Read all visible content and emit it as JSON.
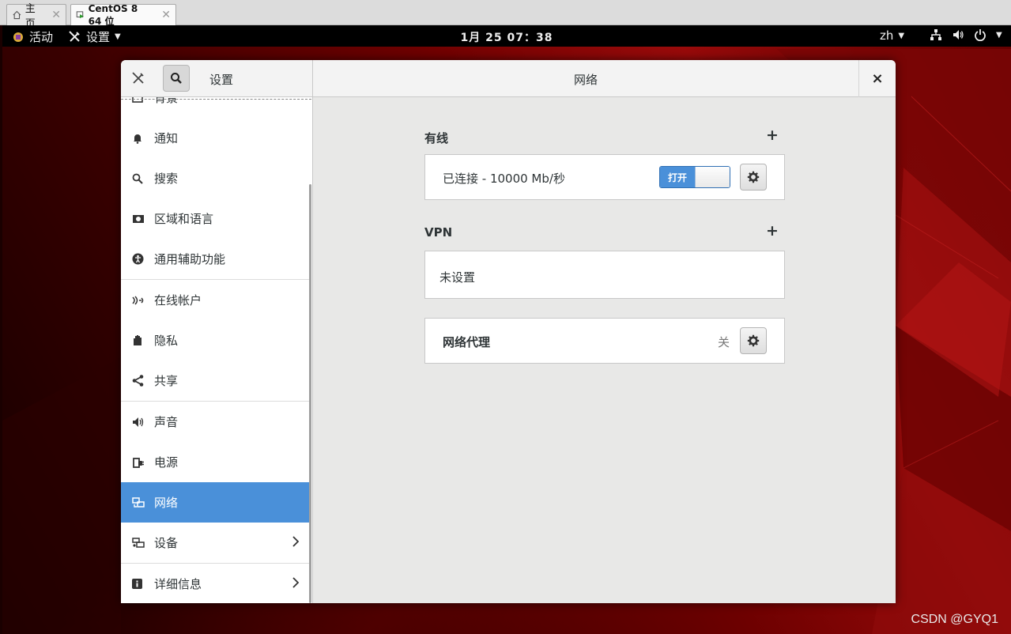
{
  "vmware_tabs": [
    {
      "label": "主页"
    },
    {
      "label": "CentOS 8 64 位"
    }
  ],
  "topbar": {
    "activities": "活动",
    "app_menu": "设置",
    "clock": "1月 25  07：38",
    "input_method": "zh"
  },
  "window": {
    "sidebar_title": "设置",
    "panel_title": "网络",
    "close_glyph": "×"
  },
  "sidebar": {
    "items": [
      {
        "label": "背景",
        "icon": "background-icon"
      },
      {
        "label": "通知",
        "icon": "bell-icon"
      },
      {
        "label": "搜索",
        "icon": "search-icon"
      },
      {
        "label": "区域和语言",
        "icon": "region-icon"
      },
      {
        "label": "通用辅助功能",
        "icon": "accessibility-icon"
      },
      {
        "label": "在线帐户",
        "icon": "online-accounts-icon"
      },
      {
        "label": "隐私",
        "icon": "privacy-hand-icon"
      },
      {
        "label": "共享",
        "icon": "share-icon"
      },
      {
        "label": "声音",
        "icon": "speaker-icon"
      },
      {
        "label": "电源",
        "icon": "power-plug-icon"
      },
      {
        "label": "网络",
        "icon": "network-icon",
        "selected": true
      },
      {
        "label": "设备",
        "icon": "devices-icon",
        "has_submenu": true
      },
      {
        "label": "详细信息",
        "icon": "info-icon",
        "has_submenu": true
      }
    ]
  },
  "network": {
    "wired": {
      "title": "有线",
      "status": "已连接 - 10000 Mb/秒",
      "toggle_label": "打开",
      "toggle_on": true
    },
    "vpn": {
      "title": "VPN",
      "empty_label": "未设置"
    },
    "proxy": {
      "label": "网络代理",
      "state": "关"
    },
    "add_glyph": "+"
  },
  "watermark": "CSDN @GYQ1",
  "colors": {
    "accent": "#4a90d9",
    "topbar": "#000000",
    "window_bg": "#e8e8e7"
  }
}
